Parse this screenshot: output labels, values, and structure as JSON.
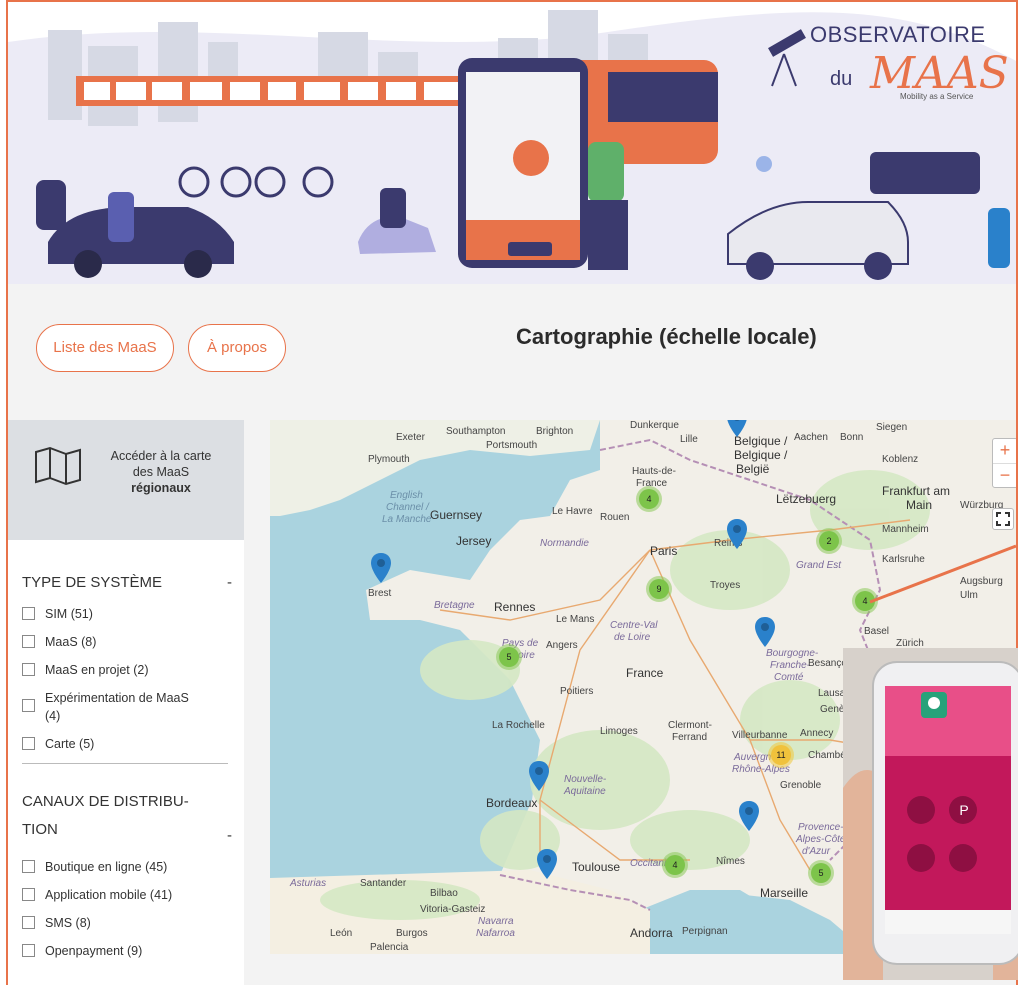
{
  "logo": {
    "title": "OBSERVATOIRE",
    "du": "du",
    "maas": "MAAS",
    "tagline": "Mobility as a Service"
  },
  "nav": {
    "list_label": "Liste des MaaS",
    "about_label": "À propos",
    "page_title": "Cartographie (échelle locale)"
  },
  "sidebar": {
    "map_link": {
      "line1": "Accéder à la carte",
      "line2": "des MaaS",
      "line3": "régionaux"
    },
    "sections": [
      {
        "title": "TYPE DE SYSTÈME",
        "toggle": "-",
        "options": [
          "SIM (51)",
          "MaaS (8)",
          "MaaS en projet (2)",
          "Expérimentation de MaaS (4)",
          "Carte (5)"
        ]
      },
      {
        "title_line1": "CANAUX DE DISTRIBU-",
        "title_line2": "TION",
        "toggle": "-",
        "options": [
          "Boutique en ligne (45)",
          "Application mobile (41)",
          "SMS (8)",
          "Openpayment (9)"
        ]
      }
    ]
  },
  "map": {
    "zoom_in": "+",
    "zoom_out": "−",
    "labels": {
      "exeter": "Exeter",
      "southampton": "Southampton",
      "brighton": "Brighton",
      "portsmouth": "Portsmouth",
      "plymouth": "Plymouth",
      "dunkerque": "Dunkerque",
      "lille": "Lille",
      "belgique": "Belgique /",
      "belgique2": "Belgique /",
      "belgien": "België",
      "aachen": "Aachen",
      "bonn": "Bonn",
      "siegen": "Siegen",
      "koblenz": "Koblenz",
      "frankfurt": "Frankfurt am",
      "main": "Main",
      "wurzburg": "Würzburg",
      "letzebuerg": "Lëtzebuerg",
      "english_channel": "English",
      "channel2": "Channel /",
      "manche": "La Manche",
      "guernsey": "Guernsey",
      "jersey": "Jersey",
      "lehavre": "Le Havre",
      "rouen": "Rouen",
      "normandie": "Normandie",
      "paris": "Paris",
      "reims": "Reims",
      "mannheim": "Mannheim",
      "karlsruhe": "Karlsruhe",
      "grandest": "Grand Est",
      "brest": "Brest",
      "bretagne": "Bretagne",
      "rennes": "Rennes",
      "lemans": "Le Mans",
      "troyes": "Troyes",
      "augsburg": "Augsburg",
      "ulm": "Ulm",
      "angers": "Angers",
      "centre": "Centre-Val",
      "deloire": "de Loire",
      "basel": "Basel",
      "zurich": "Zürich",
      "paysde": "Pays de",
      "laloire": "la Loire",
      "france": "France",
      "bourgogne": "Bourgogne-",
      "franche": "Franche-",
      "comte": "Comté",
      "besancon": "Besançon",
      "poitiers": "Poitiers",
      "lausanne": "Lausanne",
      "geneve": "Genève",
      "larochelle": "La Rochelle",
      "limoges": "Limoges",
      "clermont": "Clermont-",
      "ferrand": "Ferrand",
      "villeurbanne": "Villeurbanne",
      "annecy": "Annecy",
      "auvergne": "Auvergne-",
      "rhone": "Rhône-Alpes",
      "chambery": "Chambéry",
      "nouvelle": "Nouvelle-",
      "aquitaine": "Aquitaine",
      "grenoble": "Grenoble",
      "bordeaux": "Bordeaux",
      "provence": "Provence-",
      "alpes": "Alpes-Côte",
      "dazur": "d'Azur",
      "toulouse": "Toulouse",
      "occitanie": "Occitanie",
      "nimes": "Nîmes",
      "marseille": "Marseille",
      "santander": "Santander",
      "bilbao": "Bilbao",
      "asturias": "Asturias",
      "vitoria": "Vitoria-Gasteiz",
      "navarra": "Navarra",
      "nafarroa": "Nafarroa",
      "leon": "León",
      "burgos": "Burgos",
      "andorra": "Andorra",
      "perpignan": "Perpignan",
      "palencia": "Palencia",
      "hauts": "Hauts-de-",
      "hfrance": "France"
    },
    "clusters": [
      "4",
      "2",
      "9",
      "4",
      "5",
      "11",
      "4",
      "5"
    ]
  },
  "colors": {
    "accent": "#e8734a",
    "cluster_green": "#7dc44a",
    "cluster_yellow": "#f0c23c",
    "pin_blue": "#2a81cb",
    "water": "#aad3df"
  }
}
